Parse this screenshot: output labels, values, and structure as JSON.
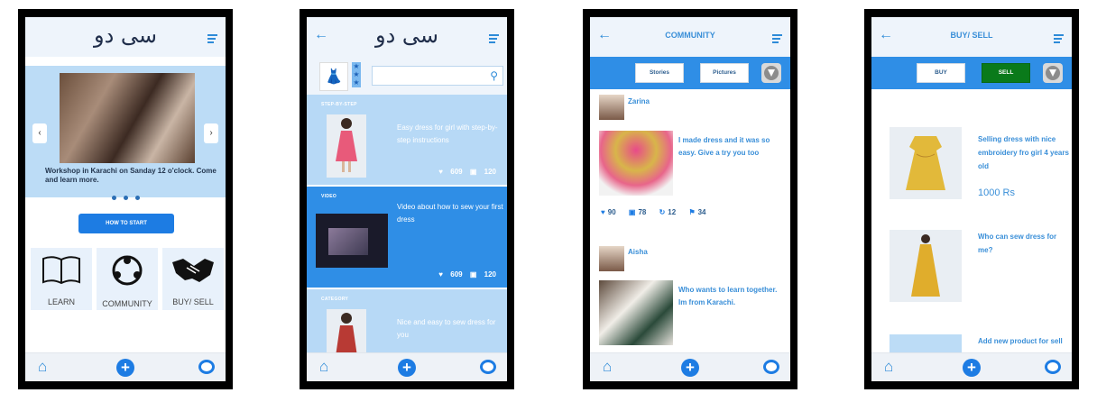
{
  "colors": {
    "primary": "#1d7ce3",
    "light_blue": "#b7d9f6",
    "active_green": "#0a7a1a",
    "link_blue": "#3a8fd8"
  },
  "icons": [
    "back-arrow-icon",
    "menu-icon",
    "home-icon",
    "plus-icon",
    "chat-icon",
    "search-icon",
    "heart-icon",
    "comment-icon",
    "repost-icon",
    "bookmark-icon",
    "filter-icon",
    "star-icon"
  ],
  "screen1": {
    "logo": "سی دو",
    "carousel": {
      "caption": "Workshop in Karachi on Sanday 12 o'clock. Come and learn more.",
      "prev": "‹",
      "next": "›"
    },
    "start_button": "HOW TO START",
    "tiles": [
      {
        "label": "LEARN"
      },
      {
        "label": "COMMUNITY"
      },
      {
        "label": "BUY/ SELL"
      }
    ]
  },
  "screen2": {
    "logo": "سی دو",
    "cards": [
      {
        "kicker": "STEP-BY-STEP",
        "desc": "Easy dress for girl with step-by-step instructions",
        "likes": "609",
        "comments": "120"
      },
      {
        "kicker": "VIDEO",
        "desc": "Video about how to sew your first dress",
        "likes": "609",
        "comments": "120"
      },
      {
        "kicker": "CATEGORY",
        "desc": "Nice and easy to sew dress for you"
      }
    ]
  },
  "screen3": {
    "title": "COMMUNITY",
    "tabs": [
      "Stories",
      "Pictures"
    ],
    "posts": [
      {
        "user": "Zarina",
        "text": "I made dress and it was so easy. Give a try you too",
        "likes": "90",
        "comments": "78",
        "reposts": "12",
        "saves": "34"
      },
      {
        "user": "Aisha",
        "text": "Who wants to learn together. Im from Karachi."
      }
    ]
  },
  "screen4": {
    "title": "BUY/ SELL",
    "tabs": [
      "BUY",
      "SELL"
    ],
    "products": [
      {
        "text": "Selling dress with nice embroidery fro girl 4 years old",
        "price": "1000 Rs"
      },
      {
        "text": "Who can sew dress for me?"
      },
      {
        "text": "Add new product for sell"
      }
    ]
  }
}
